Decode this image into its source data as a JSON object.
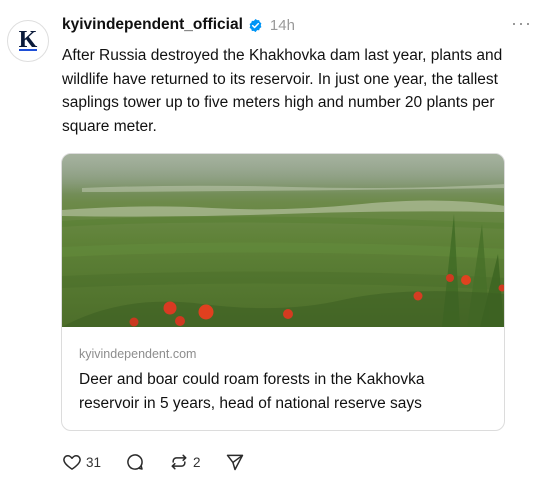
{
  "post": {
    "avatar_letter": "K",
    "username": "kyivindependent_official",
    "time": "14h",
    "more": "···",
    "text": "After Russia destroyed the Khakhovka dam last year, plants and wildlife have returned to its reservoir. In just one year, the tallest saplings tower up to five meters high and number 20 plants per square meter."
  },
  "link_card": {
    "domain": "kyivindependent.com",
    "title": "Deer and boar could roam forests in the Kakhovka reservoir in 5 years, head of national reserve says"
  },
  "actions": {
    "like_count": "31",
    "repost_count": "2"
  },
  "icons": {
    "verified": "verified-badge-icon",
    "like": "heart-icon",
    "reply": "speech-bubble-icon",
    "repost": "repost-arrows-icon",
    "share": "paper-plane-icon"
  },
  "colors": {
    "verified": "#0095f6",
    "avatar_accent": "#1e4fd7",
    "muted": "#9a9a9a"
  }
}
